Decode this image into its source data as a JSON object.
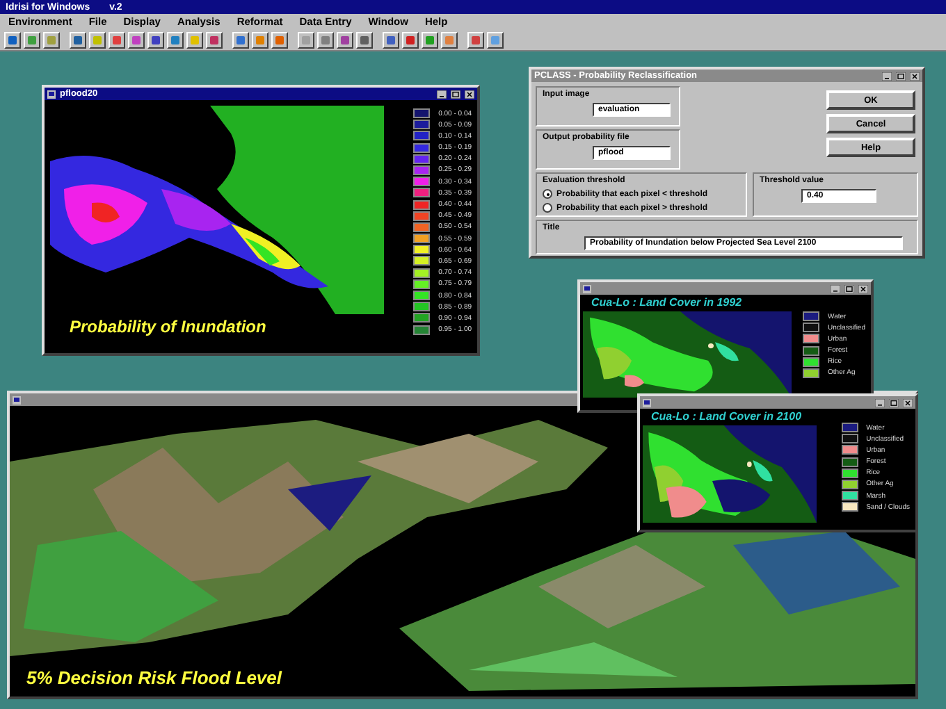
{
  "app": {
    "title": "Idrisi for Windows",
    "version": "v.2"
  },
  "menu": [
    "Environment",
    "File",
    "Display",
    "Analysis",
    "Reformat",
    "Data Entry",
    "Window",
    "Help"
  ],
  "probability_map": {
    "title": "pflood20",
    "caption": "Probability of Inundation",
    "legend": [
      {
        "range": "0.00 - 0.04",
        "color": "#14146e"
      },
      {
        "range": "0.05 - 0.09",
        "color": "#1c1c9c"
      },
      {
        "range": "0.10 - 0.14",
        "color": "#2222c4"
      },
      {
        "range": "0.15 - 0.19",
        "color": "#3428e0"
      },
      {
        "range": "0.20 - 0.24",
        "color": "#6424f0"
      },
      {
        "range": "0.25 - 0.29",
        "color": "#a824f0"
      },
      {
        "range": "0.30 - 0.34",
        "color": "#f020e8"
      },
      {
        "range": "0.35 - 0.39",
        "color": "#f02080"
      },
      {
        "range": "0.40 - 0.44",
        "color": "#f02424"
      },
      {
        "range": "0.45 - 0.49",
        "color": "#f04424"
      },
      {
        "range": "0.50 - 0.54",
        "color": "#f06424"
      },
      {
        "range": "0.55 - 0.59",
        "color": "#f0a024"
      },
      {
        "range": "0.60 - 0.64",
        "color": "#f0f024"
      },
      {
        "range": "0.65 - 0.69",
        "color": "#d4f024"
      },
      {
        "range": "0.70 - 0.74",
        "color": "#a4f024"
      },
      {
        "range": "0.75 - 0.79",
        "color": "#64f024"
      },
      {
        "range": "0.80 - 0.84",
        "color": "#34e424"
      },
      {
        "range": "0.85 - 0.89",
        "color": "#24c424"
      },
      {
        "range": "0.90 - 0.94",
        "color": "#24a424"
      },
      {
        "range": "0.95 - 1.00",
        "color": "#248434"
      }
    ]
  },
  "dialog": {
    "title": "PCLASS - Probability Reclassification",
    "input_image": {
      "label": "Input image",
      "value": "evaluation"
    },
    "output_file": {
      "label": "Output probability file",
      "value": "pflood"
    },
    "threshold": {
      "label": "Evaluation threshold",
      "options": [
        {
          "label": "Probability that each pixel < threshold",
          "selected": true
        },
        {
          "label": "Probability that each pixel > threshold",
          "selected": false
        }
      ]
    },
    "threshold_value": {
      "label": "Threshold value",
      "value": "0.40"
    },
    "title_field": {
      "label": "Title",
      "value": "Probability of Inundation below Projected Sea Level 2100"
    },
    "buttons": [
      "OK",
      "Cancel",
      "Help"
    ]
  },
  "land_cover_1992": {
    "caption": "Cua-Lo : Land Cover in 1992",
    "legend": [
      {
        "label": "Water",
        "color": "#1c1c80"
      },
      {
        "label": "Unclassified",
        "color": "#101010"
      },
      {
        "label": "Urban",
        "color": "#f08c8c"
      },
      {
        "label": "Forest",
        "color": "#145c14"
      },
      {
        "label": "Rice",
        "color": "#30e030"
      },
      {
        "label": "Other Ag",
        "color": "#90d030"
      }
    ]
  },
  "land_cover_2100": {
    "caption": "Cua-Lo : Land Cover in 2100",
    "legend": [
      {
        "label": "Water",
        "color": "#1c1c80"
      },
      {
        "label": "Unclassified",
        "color": "#101010"
      },
      {
        "label": "Urban",
        "color": "#f08c8c"
      },
      {
        "label": "Forest",
        "color": "#145c14"
      },
      {
        "label": "Rice",
        "color": "#30e030"
      },
      {
        "label": "Other Ag",
        "color": "#90d030"
      },
      {
        "label": "Marsh",
        "color": "#30e0a0"
      },
      {
        "label": "Sand / Clouds",
        "color": "#f8e8c0"
      }
    ]
  },
  "terrain_view": {
    "caption": "5% Decision Risk Flood Level"
  }
}
